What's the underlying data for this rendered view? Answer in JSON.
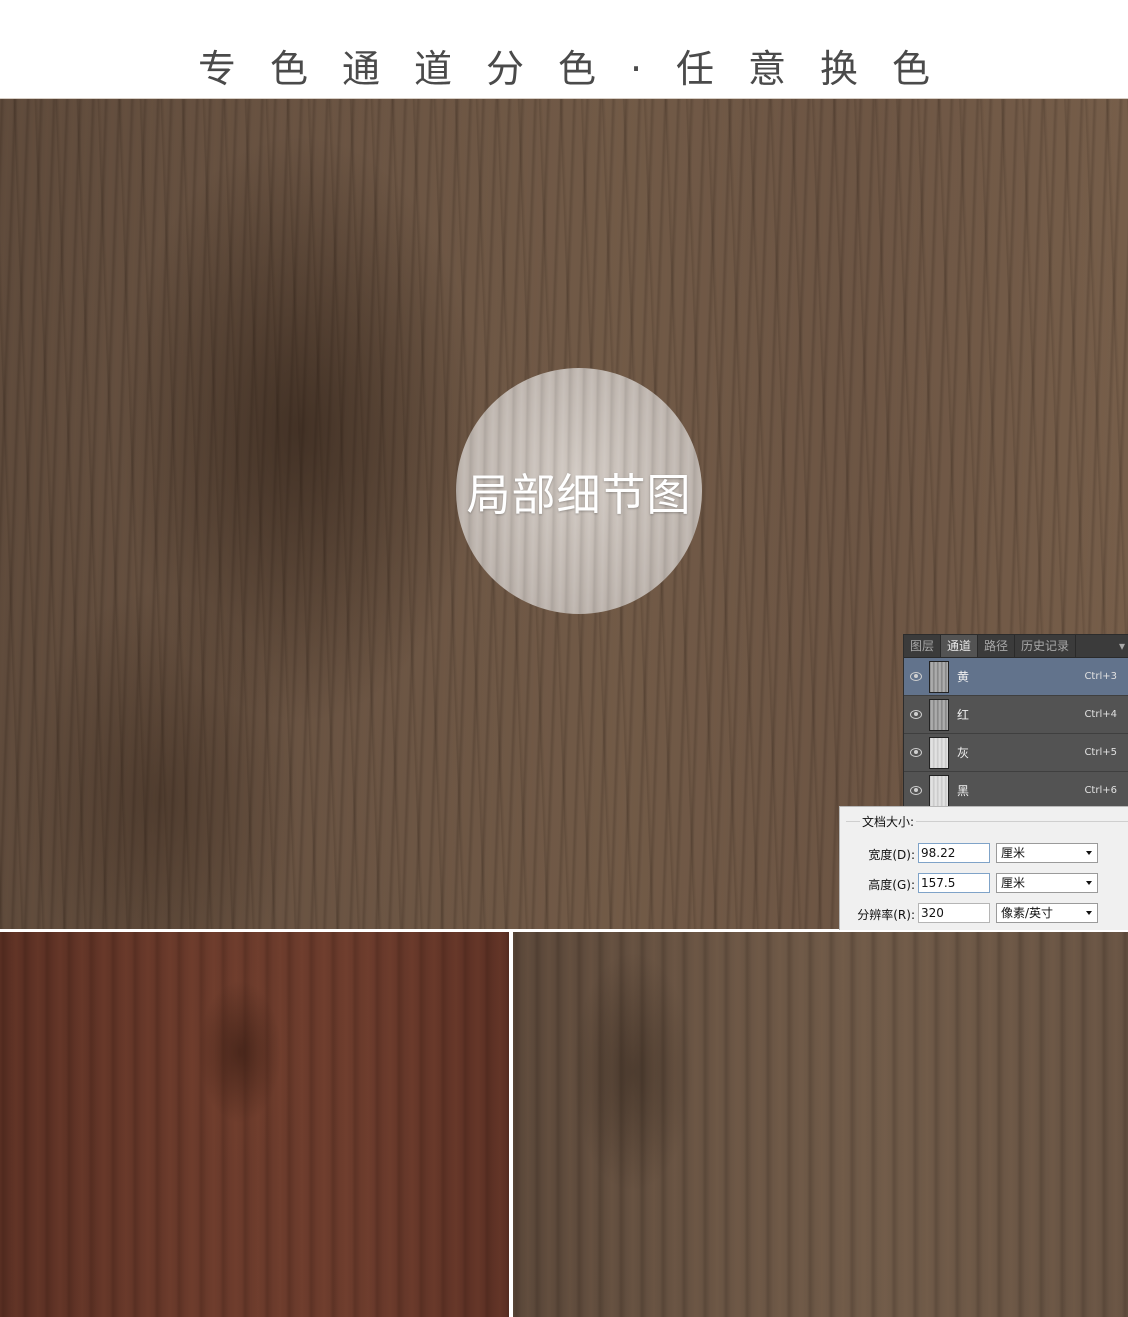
{
  "header": {
    "title": "专色通道分色·任意换色"
  },
  "main_image": {
    "badge_label": "局部细节图"
  },
  "channels_panel": {
    "tabs": [
      "图层",
      "通道",
      "路径",
      "历史记录"
    ],
    "active_tab": "通道",
    "channels": [
      {
        "name": "黄",
        "shortcut": "Ctrl+3",
        "selected": true
      },
      {
        "name": "红",
        "shortcut": "Ctrl+4",
        "selected": false
      },
      {
        "name": "灰",
        "shortcut": "Ctrl+5",
        "selected": false
      },
      {
        "name": "黑",
        "shortcut": "Ctrl+6",
        "selected": false
      }
    ]
  },
  "document_size": {
    "legend": "文档大小:",
    "width": {
      "label": "宽度(D):",
      "value": "98.22",
      "unit": "厘米"
    },
    "height": {
      "label": "高度(G):",
      "value": "157.5",
      "unit": "厘米"
    },
    "resolution": {
      "label": "分辨率(R):",
      "value": "320",
      "unit": "像素/英寸"
    }
  },
  "colors": {
    "selected_row": "#62738c",
    "panel_bg": "#535353",
    "dialog_bg": "#f0f0f0"
  }
}
